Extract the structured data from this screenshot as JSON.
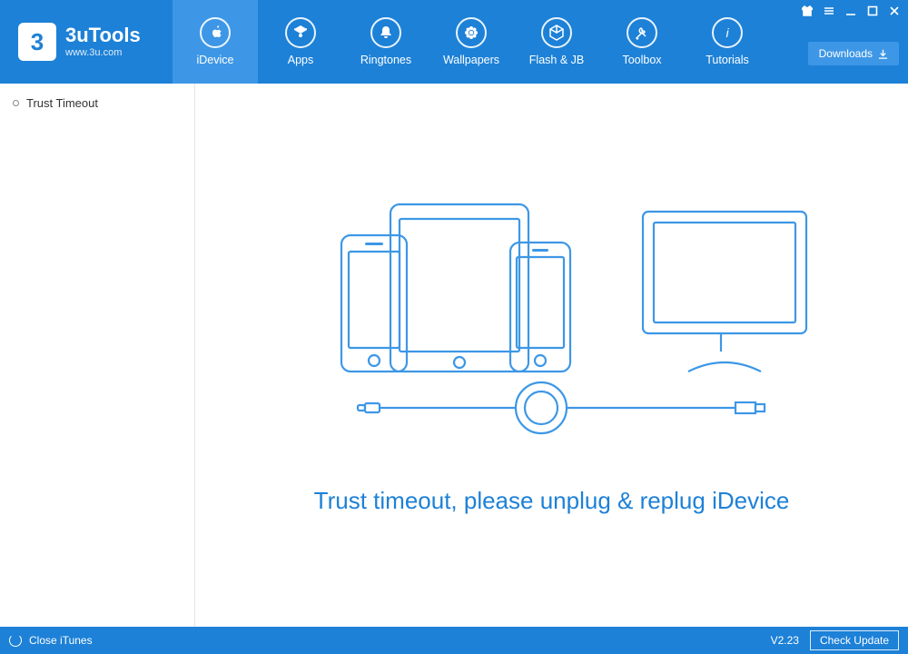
{
  "app": {
    "title": "3uTools",
    "subtitle": "www.3u.com"
  },
  "nav": {
    "items": [
      {
        "label": "iDevice",
        "name": "nav-idevice",
        "icon": "apple-icon",
        "active": true
      },
      {
        "label": "Apps",
        "name": "nav-apps",
        "icon": "apps-icon",
        "active": false
      },
      {
        "label": "Ringtones",
        "name": "nav-ringtones",
        "icon": "bell-icon",
        "active": false
      },
      {
        "label": "Wallpapers",
        "name": "nav-wallpapers",
        "icon": "flower-icon",
        "active": false
      },
      {
        "label": "Flash & JB",
        "name": "nav-flash-jb",
        "icon": "box-icon",
        "active": false
      },
      {
        "label": "Toolbox",
        "name": "nav-toolbox",
        "icon": "tools-icon",
        "active": false
      },
      {
        "label": "Tutorials",
        "name": "nav-tutorials",
        "icon": "info-icon",
        "active": false
      }
    ]
  },
  "header": {
    "downloads_label": "Downloads"
  },
  "sidebar": {
    "items": [
      {
        "label": "Trust Timeout"
      }
    ]
  },
  "main": {
    "message": "Trust timeout, please unplug & replug iDevice"
  },
  "footer": {
    "left_label": "Close iTunes",
    "version": "V2.23",
    "check_update_label": "Check Update"
  }
}
